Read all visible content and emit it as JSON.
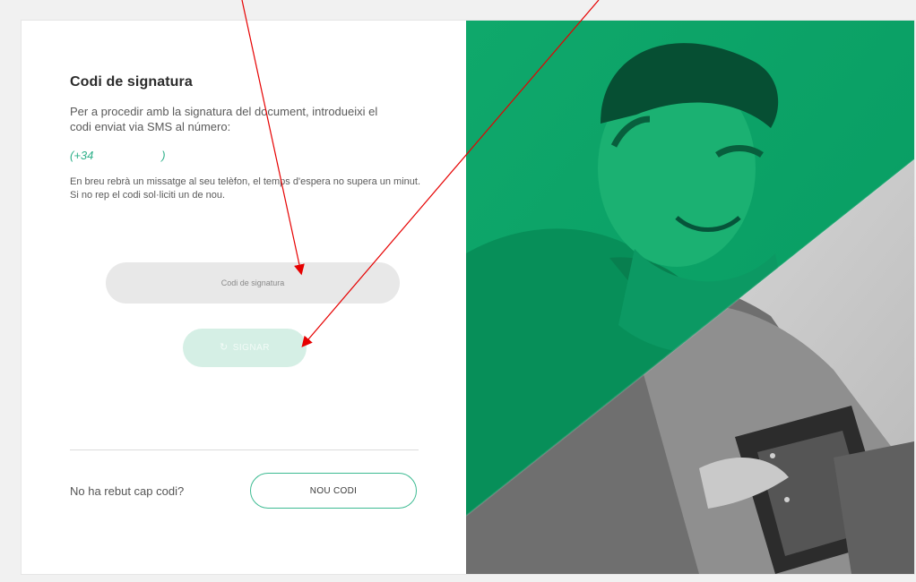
{
  "form": {
    "title": "Codi de signatura",
    "intro": "Per a procedir amb la signatura del document, introdueixi el codi enviat via SMS al número:",
    "phone": "(+34                     )",
    "notice": "En breu rebrà un missatge al seu telèfon, el temps d'espera no supera un minut. Si no rep el codi sol·liciti un de nou.",
    "code_input": {
      "placeholder": "Codi de signatura",
      "value": ""
    },
    "sign_button_label": "SIGNAR",
    "no_code_label": "No ha rebut cap codi?",
    "new_code_button_label": "NOU CODI"
  },
  "icons": {
    "sign_button_icon": "refresh-icon"
  },
  "colors": {
    "accent": "#3dbb92",
    "hero_green": "#0ea66a",
    "disabled_button": "#d5efe5",
    "annotation_arrow": "#e60000"
  }
}
